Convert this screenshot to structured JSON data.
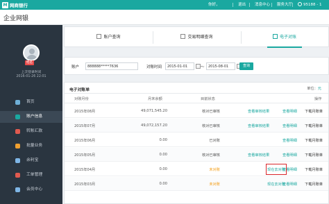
{
  "topbar": {
    "logo_text": "网商银行",
    "greeting": "你好，",
    "logout": "退出",
    "messages": "消息中心",
    "service_hall": "服务大厅",
    "hotline": "95188 - 1"
  },
  "page_title": "企业网银",
  "sidebar": {
    "user_badge": "姓名",
    "login_label": "上次登录时间",
    "login_time": "2016-01-26 22:01",
    "items": [
      {
        "label": "首页",
        "icon": "home-icon",
        "color": "#6fb0d8"
      },
      {
        "label": "账户信息",
        "icon": "account-icon",
        "color": "#1aa8a0",
        "active": true
      },
      {
        "label": "转账汇款",
        "icon": "transfer-icon",
        "color": "#e05a4f"
      },
      {
        "label": "批量业务",
        "icon": "batch-icon",
        "color": "#f0a030"
      },
      {
        "label": "余利宝",
        "icon": "wallet-icon",
        "color": "#7fb6e6"
      },
      {
        "label": "工单管理",
        "icon": "ticket-icon",
        "color": "#e05a4f"
      },
      {
        "label": "会员中心",
        "icon": "member-icon",
        "color": "#7fb6e6"
      }
    ]
  },
  "tabs": [
    {
      "label": "账户查询"
    },
    {
      "label": "交易明细查询"
    },
    {
      "label": "电子对账",
      "active": true
    }
  ],
  "filter": {
    "account_label": "账户",
    "account_value": "888888*****7636",
    "period_label": "对账时间",
    "date_start": "2015-01-01",
    "date_sep": "～",
    "date_end": "2015-08-01",
    "query_button": "查询"
  },
  "bill": {
    "title": "电子对账单",
    "unit_label": "单位：",
    "unit_value": "元",
    "headers": {
      "month": "对账月份",
      "balance": "月末余额",
      "status": "目前状态",
      "action": "操作"
    },
    "rows": [
      {
        "month": "2015年08月",
        "balance": "49,071,545.20",
        "status": "核对已审核",
        "a1": "查看审核结果",
        "a2": "查看明细",
        "a3": "下载月账单"
      },
      {
        "month": "2015年07月",
        "balance": "49,072,157.20",
        "status": "核对已审核",
        "a1": "查看审核结果",
        "a2": "查看明细",
        "a3": "下载月账单"
      },
      {
        "month": "2015年06月",
        "balance": "0.00",
        "status": "已对账",
        "a1": "",
        "a2": "查看明细",
        "a3": "下载月账单"
      },
      {
        "month": "2015年05月",
        "balance": "0.00",
        "status": "核对已审核",
        "a1": "查看审核结果",
        "a2": "查看明细",
        "a3": "下载月账单"
      },
      {
        "month": "2015年04月",
        "balance": "0.00",
        "status": "未对账",
        "a1": "现在去对账",
        "a2": "查看明细",
        "a3": "下载月账单"
      },
      {
        "month": "2015年03月",
        "balance": "0.00",
        "status": "未对账",
        "a1": "现在去对账",
        "a2": "查看明细",
        "a3": "下载月账单"
      }
    ]
  }
}
